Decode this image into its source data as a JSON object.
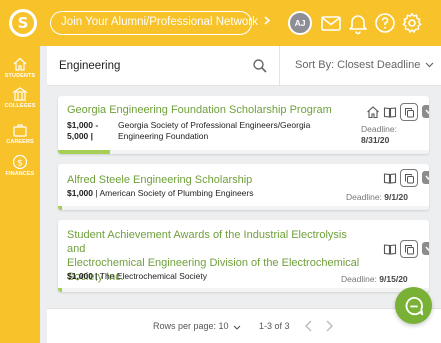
{
  "header": {
    "logo_letter": "S",
    "join_label": "Join Your Alumni/Professional Network",
    "avatar_initials": "AJ"
  },
  "sidebar": {
    "items": [
      {
        "label": "STUDENTS"
      },
      {
        "label": "COLLEGES"
      },
      {
        "label": "CAREERS"
      },
      {
        "label": "FINANCES"
      }
    ]
  },
  "search": {
    "value": "Engineering",
    "sort_label": "Sort By: Closest Deadline"
  },
  "scholarships": [
    {
      "title": "Georgia Engineering Foundation Scholarship Program",
      "amount_line1": "$1,000 -",
      "amount_line2": "5,000 |",
      "org_line1": "Georgia Society of Professional Engineers/Georgia",
      "org_line2": "Engineering Foundation",
      "deadline_label": "Deadline:",
      "deadline_value": "8/31/20",
      "progress": 0.14
    },
    {
      "title": "Alfred Steele Engineering Scholarship",
      "amount": "$1,000",
      "org": "American Society of Plumbing Engineers",
      "deadline_label": "Deadline:",
      "deadline_value": "9/1/20",
      "progress": 0.01
    },
    {
      "title_line1": "Student Achievement Awards of the Industrial Electrolysis and",
      "title_line2": "Electrochemical Engineering Division of the Electrochemical",
      "title_line3": "Society Inc.",
      "amount": "$1,000",
      "org": "The Electrochemical Society",
      "deadline_label": "Deadline:",
      "deadline_value": "9/15/20",
      "progress": 0.01
    }
  ],
  "pager": {
    "rows_label": "Rows per page: 10",
    "range_label": "1-3 of 3"
  },
  "colors": {
    "brand_yellow": "#f8c22b",
    "title_green": "#6fa03b",
    "progress_green": "#a6cf55",
    "fab_green": "#78b136"
  }
}
